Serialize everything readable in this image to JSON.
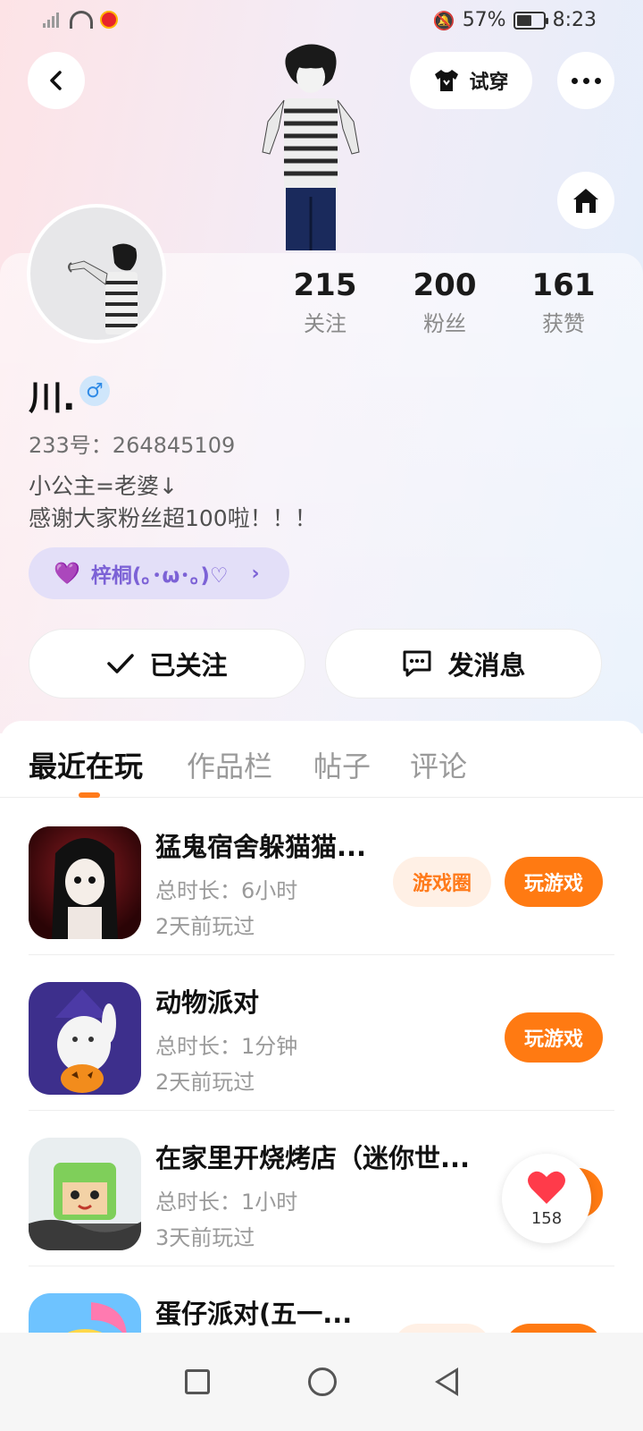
{
  "status_bar": {
    "battery": "57%",
    "time": "8:23"
  },
  "header": {
    "tryon_label": "试穿"
  },
  "profile": {
    "username": "川.",
    "gender_symbol": "♂",
    "uid_text": "233号：264845109",
    "bio_lines": [
      "小公主=老婆↓",
      "感谢大家粉丝超100啦！！！"
    ],
    "tag_text": "梓桐(｡･ω･｡)♡",
    "stats": [
      {
        "value": "215",
        "label": "关注"
      },
      {
        "value": "200",
        "label": "粉丝"
      },
      {
        "value": "161",
        "label": "获赞"
      }
    ],
    "follow_label": "已关注",
    "message_label": "发消息"
  },
  "tabs": [
    "最近在玩",
    "作品栏",
    "帖子",
    "评论"
  ],
  "games": [
    {
      "title": "猛鬼宿舍躲猫猫...",
      "duration": "总时长：6小时",
      "last_played": "2天前玩过",
      "circle_label": "游戏圈",
      "play_label": "玩游戏"
    },
    {
      "title": "动物派对",
      "duration": "总时长：1分钟",
      "last_played": "2天前玩过",
      "play_label": "玩游戏"
    },
    {
      "title": "在家里开烧烤店（迷你世...",
      "duration": "总时长：1小时",
      "last_played": "3天前玩过",
      "play_label": "玩游戏"
    },
    {
      "title": "蛋仔派对(五一..."
    }
  ],
  "floating_like": {
    "count": "158"
  },
  "colors": {
    "accent": "#ff7a12",
    "tag_purple": "#7c62d6",
    "gender_blue": "#2f8ae6"
  }
}
